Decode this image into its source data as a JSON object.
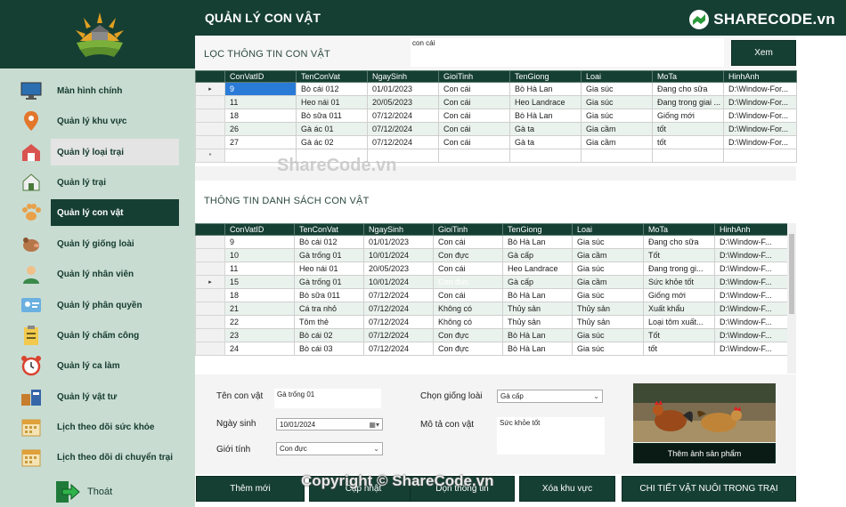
{
  "header": {
    "title": "QUẢN LÝ CON VẬT",
    "brand": "SHARECODE.vn"
  },
  "sidebar": {
    "items": [
      {
        "label": "Màn hình chính",
        "icon": "monitor-icon"
      },
      {
        "label": "Quản lý khu vực",
        "icon": "location-pin-icon"
      },
      {
        "label": "Quản lý loại trại",
        "icon": "barn-icon"
      },
      {
        "label": "Quản lý trại",
        "icon": "farmhouse-icon"
      },
      {
        "label": "Quản lý con vật",
        "icon": "paw-icon"
      },
      {
        "label": "Quản lý giống loài",
        "icon": "pig-icon"
      },
      {
        "label": "Quản lý nhân viên",
        "icon": "employee-icon"
      },
      {
        "label": "Quản lý phân quyền",
        "icon": "id-card-icon"
      },
      {
        "label": "Quản lý chấm công",
        "icon": "clipboard-icon"
      },
      {
        "label": "Quản lý ca làm",
        "icon": "alarm-clock-icon"
      },
      {
        "label": "Quản lý vật tư",
        "icon": "supplies-icon"
      },
      {
        "label": "Lịch theo dõi sức khỏe",
        "icon": "calendar-icon"
      },
      {
        "label": "Lịch theo dõi di chuyển trại",
        "icon": "calendar-icon"
      }
    ],
    "logout": "Thoát"
  },
  "filter": {
    "title": "LỌC THÔNG TIN CON VẬT",
    "search_value": "con cái",
    "view_button": "Xem"
  },
  "columns": [
    "ConVatID",
    "TenConVat",
    "NgaySinh",
    "GioiTinh",
    "TenGiong",
    "Loai",
    "MoTa",
    "HinhAnh"
  ],
  "filter_rows": [
    [
      "9",
      "Bò cái 012",
      "01/01/2023",
      "Con cái",
      "Bò Hà Lan",
      "Gia súc",
      "Đang cho sữa",
      "D:\\Window-For..."
    ],
    [
      "11",
      "Heo nái 01",
      "20/05/2023",
      "Con cái",
      "Heo Landrace",
      "Gia súc",
      "Đang trong giai ...",
      "D:\\Window-For..."
    ],
    [
      "18",
      "Bò sữa 011",
      "07/12/2024",
      "Con cái",
      "Bò Hà Lan",
      "Gia súc",
      "Giống mới",
      "D:\\Window-For..."
    ],
    [
      "26",
      "Gà ác 01",
      "07/12/2024",
      "Con cái",
      "Gà ta",
      "Gia cầm",
      "tốt",
      "D:\\Window-For..."
    ],
    [
      "27",
      "Gà ác 02",
      "07/12/2024",
      "Con cái",
      "Gà ta",
      "Gia cầm",
      "tốt",
      "D:\\Window-For..."
    ]
  ],
  "list": {
    "title": "THÔNG TIN DANH SÁCH CON VẬT"
  },
  "list_rows": [
    [
      "9",
      "Bò cái 012",
      "01/01/2023",
      "Con cái",
      "Bò Hà Lan",
      "Gia súc",
      "Đang cho sữa",
      "D:\\Window-F..."
    ],
    [
      "10",
      "Gà trống 01",
      "10/01/2024",
      "Con đực",
      "Gà cấp",
      "Gia cầm",
      "Tốt",
      "D:\\Window-F..."
    ],
    [
      "11",
      "Heo nái 01",
      "20/05/2023",
      "Con cái",
      "Heo Landrace",
      "Gia súc",
      "Đang trong gi...",
      "D:\\Window-F..."
    ],
    [
      "15",
      "Gà trống 01",
      "10/01/2024",
      "Con đực",
      "Gà cấp",
      "Gia cầm",
      "Sức khỏe tốt",
      "D:\\Window-F..."
    ],
    [
      "18",
      "Bò sữa 011",
      "07/12/2024",
      "Con cái",
      "Bò Hà Lan",
      "Gia súc",
      "Giống mới",
      "D:\\Window-F..."
    ],
    [
      "21",
      "Cá tra nhỏ",
      "07/12/2024",
      "Không có",
      "Thủy sản",
      "Thủy sản",
      "Xuất khẩu",
      "D:\\Window-F..."
    ],
    [
      "22",
      "Tôm thẻ",
      "07/12/2024",
      "Không có",
      "Thủy sản",
      "Thủy sản",
      "Loại tôm xuất...",
      "D:\\Window-F..."
    ],
    [
      "23",
      "Bò cái 02",
      "07/12/2024",
      "Con đực",
      "Bò Hà Lan",
      "Gia súc",
      "Tốt",
      "D:\\Window-F..."
    ],
    [
      "24",
      "Bò cái 03",
      "07/12/2024",
      "Con đực",
      "Bò Hà Lan",
      "Gia súc",
      "tốt",
      "D:\\Window-F..."
    ]
  ],
  "form": {
    "name_label": "Tên con vật",
    "name_value": "Gà trống 01",
    "dob_label": "Ngày sinh",
    "dob_value": "10/01/2024",
    "gender_label": "Giới tính",
    "gender_value": "Con đực",
    "breed_label": "Chọn giống loài",
    "breed_value": "Gà cấp",
    "desc_label": "Mô tả con vật",
    "desc_value": "Sức khỏe tốt",
    "add_image_button": "Thêm ảnh sản phẩm"
  },
  "actions": [
    "Thêm mới",
    "Cập nhật",
    "Dọn thông tin",
    "Xóa khu vực",
    "CHI TIẾT VẬT NUÔI TRONG TRẠI"
  ],
  "watermarks": {
    "center": "ShareCode.vn",
    "copyright": "Copyright © ShareCode.vn"
  },
  "colors": {
    "primary": "#163f33",
    "sidebar_bg": "#c9dcd2",
    "selection": "#2a7bd8",
    "alt_row": "#eaf2ee"
  }
}
